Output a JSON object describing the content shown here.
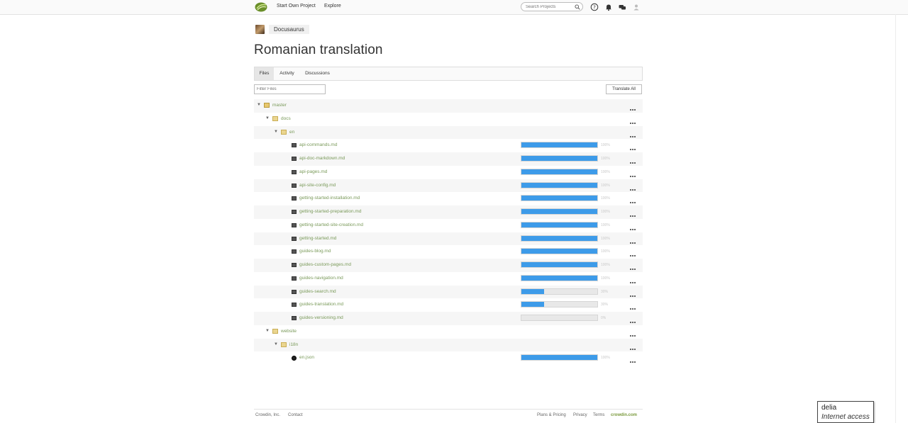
{
  "topbar": {
    "nav": [
      "Start Own Project",
      "Explore"
    ],
    "search_placeholder": "Search Projects",
    "icons": [
      "crowdin-logo-icon",
      "help-icon",
      "bell-icon",
      "messages-icon",
      "user-icon"
    ]
  },
  "project": {
    "name": "Docusaurus"
  },
  "page": {
    "title": "Romanian translation"
  },
  "tabs": [
    "Files",
    "Activity",
    "Discussions"
  ],
  "toolbar": {
    "filter_placeholder": "Filter Files",
    "translate_all": "Translate All"
  },
  "tree": [
    {
      "kind": "branch",
      "depth": 0,
      "name": "master"
    },
    {
      "kind": "folder",
      "depth": 1,
      "name": "docs"
    },
    {
      "kind": "folder",
      "depth": 2,
      "name": "en"
    },
    {
      "kind": "file",
      "depth": 3,
      "name": "api-commands.md",
      "progress": 100,
      "pct": "100%"
    },
    {
      "kind": "file",
      "depth": 3,
      "name": "api-doc-markdown.md",
      "progress": 100,
      "pct": "100%"
    },
    {
      "kind": "file",
      "depth": 3,
      "name": "api-pages.md",
      "progress": 100,
      "pct": "100%"
    },
    {
      "kind": "file",
      "depth": 3,
      "name": "api-site-config.md",
      "progress": 100,
      "pct": "100%"
    },
    {
      "kind": "file",
      "depth": 3,
      "name": "getting-started-installation.md",
      "progress": 100,
      "pct": "100%"
    },
    {
      "kind": "file",
      "depth": 3,
      "name": "getting-started-preparation.md",
      "progress": 100,
      "pct": "100%"
    },
    {
      "kind": "file",
      "depth": 3,
      "name": "getting-started-site-creation.md",
      "progress": 100,
      "pct": "100%"
    },
    {
      "kind": "file",
      "depth": 3,
      "name": "getting-started.md",
      "progress": 100,
      "pct": "100%"
    },
    {
      "kind": "file",
      "depth": 3,
      "name": "guides-blog.md",
      "progress": 100,
      "pct": "100%"
    },
    {
      "kind": "file",
      "depth": 3,
      "name": "guides-custom-pages.md",
      "progress": 100,
      "pct": "100%"
    },
    {
      "kind": "file",
      "depth": 3,
      "name": "guides-navigation.md",
      "progress": 100,
      "pct": "100%"
    },
    {
      "kind": "file",
      "depth": 3,
      "name": "guides-search.md",
      "progress": 30,
      "pct": "30%"
    },
    {
      "kind": "file",
      "depth": 3,
      "name": "guides-translation.md",
      "progress": 30,
      "pct": "30%"
    },
    {
      "kind": "file",
      "depth": 3,
      "name": "guides-versioning.md",
      "progress": 0,
      "pct": "0%"
    },
    {
      "kind": "folder",
      "depth": 1,
      "name": "website"
    },
    {
      "kind": "folder",
      "depth": 2,
      "name": "i18n"
    },
    {
      "kind": "json",
      "depth": 3,
      "name": "en.json",
      "progress": 100,
      "pct": "100%"
    }
  ],
  "footer": {
    "left": [
      "Crowdin, Inc.",
      "Contact"
    ],
    "right": [
      "Plans & Pricing",
      "Privacy",
      "Terms",
      "crowdin.com"
    ]
  },
  "tooltip": {
    "user": "delia",
    "status": "Internet access"
  },
  "colors": {
    "progress": "#3d9be9",
    "link": "#7a9a5a",
    "brand": "#7a9a3c"
  }
}
